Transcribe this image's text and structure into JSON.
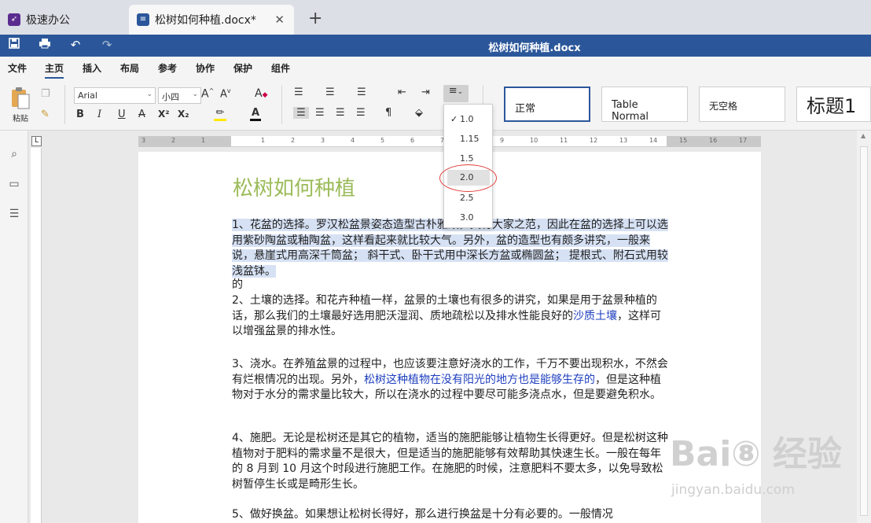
{
  "tabs": {
    "app_name": "极速办公",
    "doc_tab": "松树如何种植.docx*",
    "close": "✕",
    "new_tab": "+"
  },
  "titlebar": {
    "title": "松树如何种植.docx"
  },
  "menu": [
    "文件",
    "主页",
    "插入",
    "布局",
    "参考",
    "协作",
    "保护",
    "组件"
  ],
  "ribbon": {
    "paste_label": "粘贴",
    "font_name": "Arial",
    "font_size": "小四",
    "bold": "B",
    "italic": "I",
    "underline": "U",
    "strike": "A",
    "superscript": "X²",
    "subscript": "X₂",
    "styles": [
      "正常",
      "Table Normal",
      "无空格",
      "标题1"
    ]
  },
  "line_spacing_menu": {
    "options": [
      "1.0",
      "1.15",
      "1.5",
      "2.0",
      "2.5",
      "3.0"
    ],
    "checked": "1.0",
    "hovered": "2.0",
    "check_mark": "✓"
  },
  "document": {
    "heading": "松树如何种植",
    "p1": "1、花盆的选择。罗汉松盆景姿态造型古朴雅致，具有大家之范，因此在盆的选择上可以选用紫砂陶盆或釉陶盆，这样看起来就比较大气。另外，盆的造型也有颇多讲究，一般来说，悬崖式用高深千筒盆；   斜干式、卧干式用中深长方盆或椭圆盆；   提根式、附石式用较浅盆钵。",
    "p_de": "的",
    "p2a": "2、土壤的选择。和花卉种植一样，盆景的土壤也有很多的讲究，如果是用于盆景种植的话，那么我们的土壤最好选用肥沃湿润、质地疏松以及排水性能良好的",
    "p2_link": "沙质土壤",
    "p2b": "，这样可以增强盆景的排水性。",
    "p3a": "3、浇水。在养殖盆景的过程中，也应该要注意好浇水的工作，千万不要出现积水，不然会有烂根情况的出现。另外，",
    "p3_link": "松树这种植物在没有阳光的地方也是能够生存的",
    "p3b": "，但是这种植物对于水分的需求量比较大，所以在浇水的过程中要尽可能多浇点水，但是要避免积水。",
    "p4": "4、施肥。无论是松树还是其它的植物，适当的施肥能够让植物生长得更好。但是松树这种植物对于肥料的需求量不是很大，但是适当的施肥能够有效帮助其快速生长。一般在每年的 8 月到 10 月这个时段进行施肥工作。在施肥的时候，注意肥料不要太多，以免导致松树暂停生长或是畸形生长。",
    "p5": "5、做好换盆。如果想让松树长得好，那么进行换盆是十分有必要的。一般情况"
  },
  "ruler": {
    "marks": [
      "3",
      "2",
      "1",
      "1",
      "2",
      "3",
      "4",
      "5",
      "6",
      "7",
      "8",
      "9",
      "10",
      "11",
      "12",
      "13",
      "14",
      "15",
      "16",
      "17"
    ]
  },
  "watermark": {
    "brand": "Bai⑧ 经验",
    "url": "jingyan.baidu.com"
  },
  "colors": {
    "accent": "#2b579a",
    "heading": "#9bbb59",
    "highlight": "#d6e1f4",
    "link": "#1f3fbf",
    "circle": "#e0423a"
  }
}
